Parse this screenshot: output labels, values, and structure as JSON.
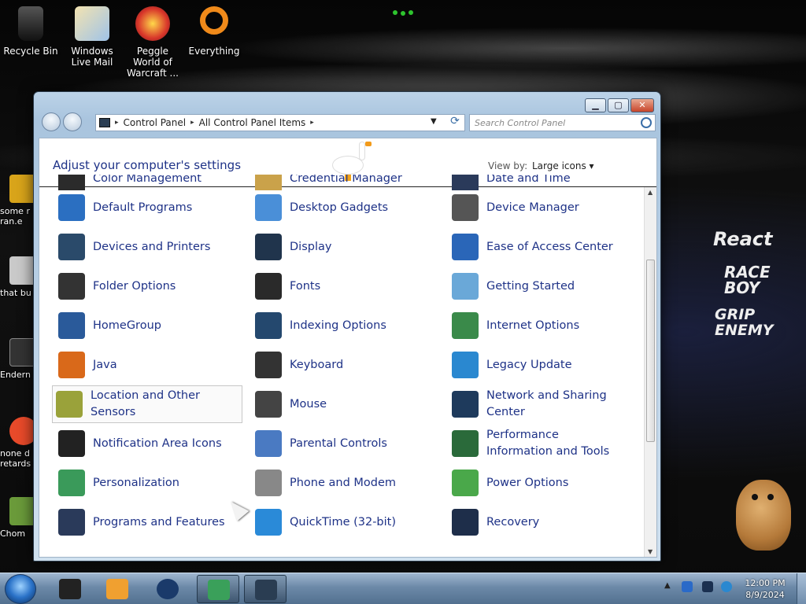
{
  "desktop": {
    "icons": [
      {
        "label": "Recycle Bin",
        "color": "#2b2b2b"
      },
      {
        "label": "Windows Live Mail",
        "color": "#e8c57a"
      },
      {
        "label": "Peggle World of Warcraft ...",
        "color": "#d8362a"
      },
      {
        "label": "Everything",
        "color": "#f08a1a"
      }
    ],
    "side_icons": [
      {
        "label": "some r ran.e",
        "color": "#d8a41a"
      },
      {
        "label": "that bu",
        "color": "#c9c9c9"
      },
      {
        "label": "Endern",
        "color": "#333"
      },
      {
        "label": "none d retards",
        "color": "#e84a2a"
      },
      {
        "label": "Chom",
        "color": "#6a9a3a"
      }
    ],
    "decals": [
      "React",
      "RACE BOY",
      "GRIP ENEMY"
    ]
  },
  "window": {
    "breadcrumb": [
      "Control Panel",
      "All Control Panel Items"
    ],
    "search_placeholder": "Search Control Panel",
    "header_title": "Adjust your computer's settings",
    "view_by_label": "View by:",
    "view_by_value": "Large icons ▾",
    "top_partial": [
      "Color Management",
      "Credential Manager",
      "Date and Time"
    ],
    "items": [
      {
        "label": "Default Programs",
        "color": "#2b6fc1"
      },
      {
        "label": "Desktop Gadgets",
        "color": "#4a8fd8"
      },
      {
        "label": "Device Manager",
        "color": "#555"
      },
      {
        "label": "Devices and Printers",
        "color": "#2a4a6a"
      },
      {
        "label": "Display",
        "color": "#20344c"
      },
      {
        "label": "Ease of Access Center",
        "color": "#2a66b8"
      },
      {
        "label": "Folder Options",
        "color": "#333"
      },
      {
        "label": "Fonts",
        "color": "#2a2a2a"
      },
      {
        "label": "Getting Started",
        "color": "#6aa8d8"
      },
      {
        "label": "HomeGroup",
        "color": "#2a5a9a"
      },
      {
        "label": "Indexing Options",
        "color": "#24486e"
      },
      {
        "label": "Internet Options",
        "color": "#3a8a4a"
      },
      {
        "label": "Java",
        "color": "#d9691a"
      },
      {
        "label": "Keyboard",
        "color": "#333"
      },
      {
        "label": "Legacy Update",
        "color": "#2a88d0"
      },
      {
        "label": "Location and Other Sensors",
        "color": "#9aa23a"
      },
      {
        "label": "Mouse",
        "color": "#444"
      },
      {
        "label": "Network and Sharing Center",
        "color": "#1e3a5c"
      },
      {
        "label": "Notification Area Icons",
        "color": "#222"
      },
      {
        "label": "Parental Controls",
        "color": "#4a7ac2"
      },
      {
        "label": "Performance Information and Tools",
        "color": "#2a6a3a"
      },
      {
        "label": "Personalization",
        "color": "#3a9a5a"
      },
      {
        "label": "Phone and Modem",
        "color": "#888"
      },
      {
        "label": "Power Options",
        "color": "#4aa84a"
      },
      {
        "label": "Programs and Features",
        "color": "#2a3a5a"
      },
      {
        "label": "QuickTime (32-bit)",
        "color": "#2a8ad8"
      },
      {
        "label": "Recovery",
        "color": "#1e2e4a"
      }
    ]
  },
  "taskbar": {
    "clock_time": "12:00 PM",
    "clock_date": "8/9/2024"
  }
}
